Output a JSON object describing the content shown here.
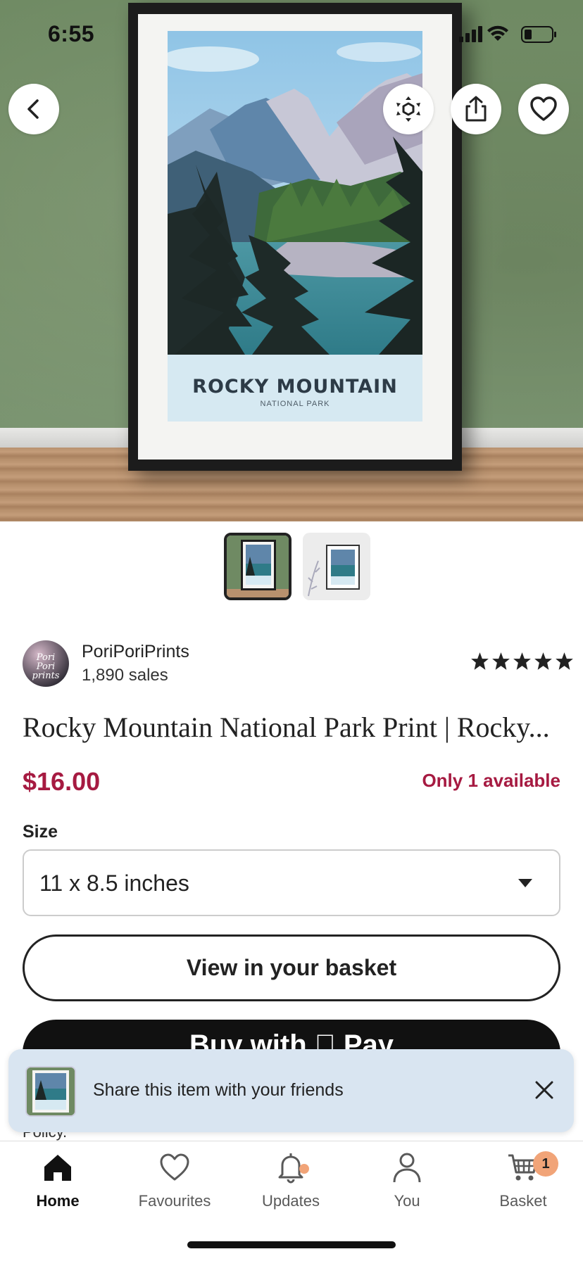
{
  "status_bar": {
    "time": "6:55"
  },
  "hero": {
    "poster_title": "ROCKY MOUNTAIN",
    "poster_subtitle": "NATIONAL PARK",
    "wall_color": "#758f68",
    "selected_thumb_index": 0,
    "thumb_count": 2
  },
  "top_buttons": [
    "back-icon",
    "ar-view-icon",
    "share-icon",
    "heart-icon"
  ],
  "shop": {
    "avatar_text": "Pori Pori prints",
    "name": "PoriPoriPrints",
    "sales": "1,890 sales",
    "rating_stars": 5
  },
  "listing": {
    "title": "Rocky Mountain National Park Print | Rocky...",
    "price": "$16.00",
    "availability": "Only 1 available",
    "accent_color": "#a61a41"
  },
  "size": {
    "label": "Size",
    "selected": "11 x 8.5 inches"
  },
  "actions": {
    "view_basket": "View in your basket",
    "buy_apple_pay": "Buy with  Pay"
  },
  "policy_fragment": "Policy.",
  "share_toast": {
    "text": "Share this item with your friends"
  },
  "tabbar": {
    "items": [
      {
        "label": "Home",
        "icon": "home-icon",
        "active": true
      },
      {
        "label": "Favourites",
        "icon": "heart-outline-icon",
        "active": false
      },
      {
        "label": "Updates",
        "icon": "bell-icon",
        "active": false
      },
      {
        "label": "You",
        "icon": "person-icon",
        "active": false
      },
      {
        "label": "Basket",
        "icon": "cart-icon",
        "active": false,
        "badge": "1"
      }
    ]
  }
}
